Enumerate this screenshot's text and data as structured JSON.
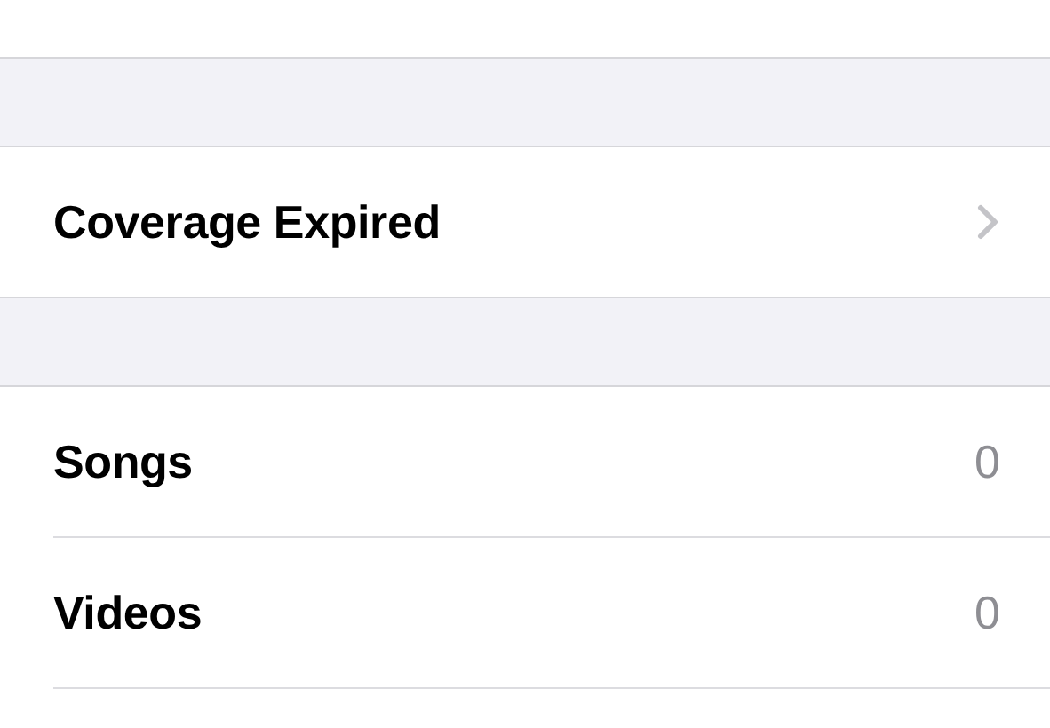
{
  "groups": [
    {
      "rows": [
        {
          "label": "Coverage Expired",
          "chevron": true
        }
      ]
    },
    {
      "rows": [
        {
          "label": "Songs",
          "value": "0"
        },
        {
          "label": "Videos",
          "value": "0"
        }
      ]
    }
  ]
}
